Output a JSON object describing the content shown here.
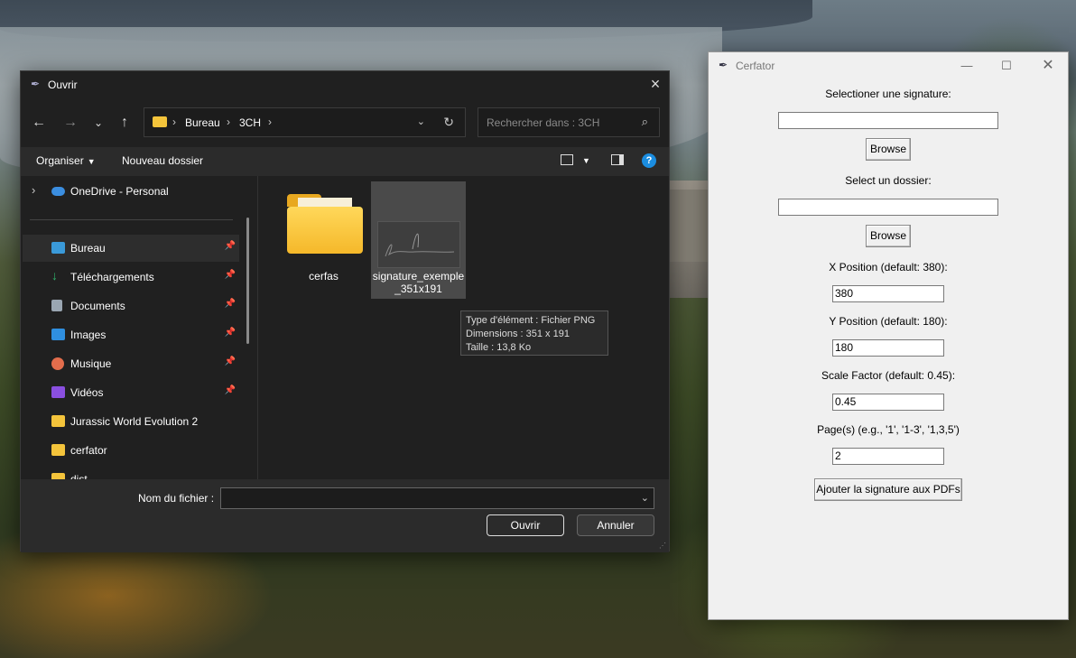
{
  "open_dialog": {
    "title": "Ouvrir",
    "address": {
      "crumbs": [
        "Bureau",
        "3CH"
      ]
    },
    "search_placeholder": "Rechercher dans : 3CH",
    "commands": {
      "organize": "Organiser",
      "new_folder": "Nouveau dossier"
    },
    "nav_items": [
      {
        "label": "OneDrive - Personal",
        "icon": "onedrive-icon",
        "color": "#3b8ee0",
        "expandable": true
      },
      {
        "label": "Bureau",
        "icon": "desktop-icon",
        "color": "#3a9ad9",
        "pinned": true,
        "selected": true
      },
      {
        "label": "Téléchargements",
        "icon": "download-icon",
        "color": "#2fb36b",
        "pinned": true
      },
      {
        "label": "Documents",
        "icon": "document-icon",
        "color": "#9aa6b2",
        "pinned": true
      },
      {
        "label": "Images",
        "icon": "image-icon",
        "color": "#2f8fe0",
        "pinned": true
      },
      {
        "label": "Musique",
        "icon": "music-icon",
        "color": "#e36d4c",
        "pinned": true
      },
      {
        "label": "Vidéos",
        "icon": "video-icon",
        "color": "#8a4fe0",
        "pinned": true
      },
      {
        "label": "Jurassic World Evolution 2",
        "icon": "folder-icon",
        "color": "#f4c43b"
      },
      {
        "label": "cerfator",
        "icon": "folder-icon",
        "color": "#f4c43b"
      },
      {
        "label": "dist",
        "icon": "folder-icon",
        "color": "#f4c43b"
      }
    ],
    "files": [
      {
        "name": "cerfas",
        "type": "folder"
      },
      {
        "name": "signature_exemple_351x191",
        "type": "image",
        "selected": true
      }
    ],
    "tooltip": [
      "Type d'élément : Fichier PNG",
      "Dimensions : 351 x 191",
      "Taille : 13,8 Ko"
    ],
    "filename_label": "Nom du fichier :",
    "filename_value": "",
    "open_button": "Ouvrir",
    "cancel_button": "Annuler"
  },
  "cerfator": {
    "title": "Cerfator",
    "signature_label": "Selectioner une signature:",
    "signature_value": "",
    "browse1": "Browse",
    "folder_label": "Select un dossier:",
    "folder_value": "",
    "browse2": "Browse",
    "x_label": "X Position (default: 380):",
    "x_value": "380",
    "y_label": "Y Position (default: 180):",
    "y_value": "180",
    "scale_label": "Scale Factor (default: 0.45):",
    "scale_value": "0.45",
    "pages_label": "Page(s) (e.g., '1', '1-3', '1,3,5')",
    "pages_value": "2",
    "submit": "Ajouter la signature aux PDFs"
  }
}
